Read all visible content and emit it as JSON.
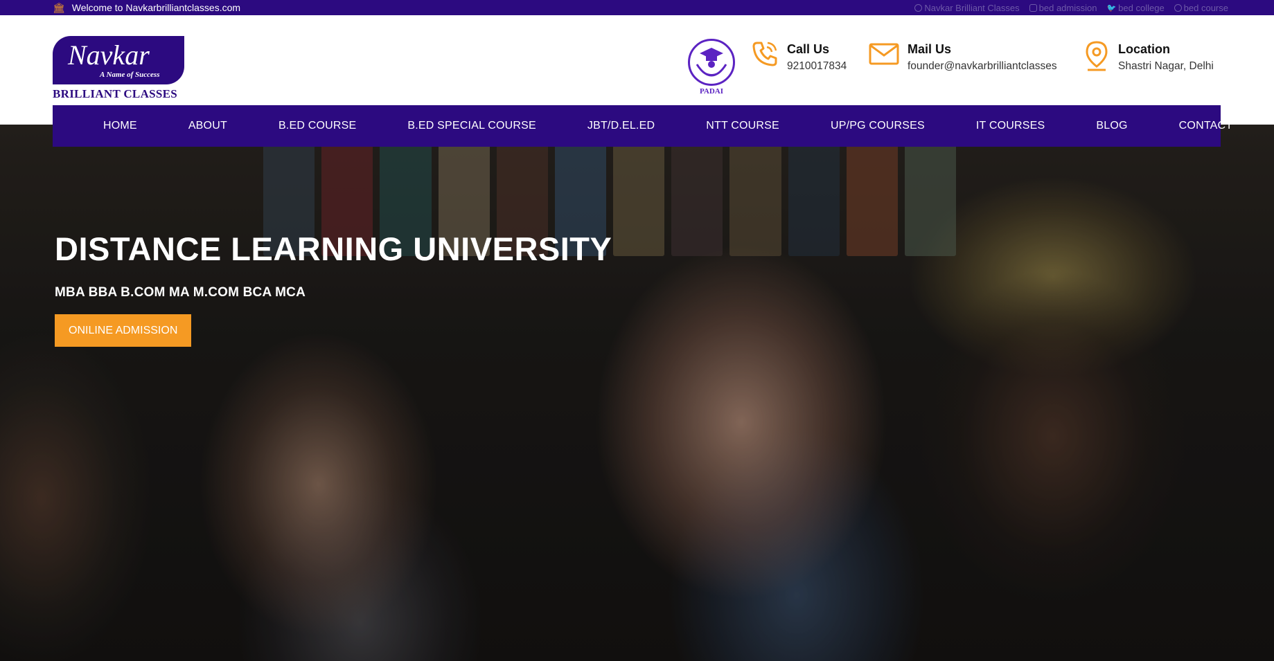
{
  "topbar": {
    "welcome": "Welcome to Navkarbrilliantclasses.com",
    "social": [
      {
        "icon": "facebook-icon",
        "label": "Navkar Brilliant Classes"
      },
      {
        "icon": "instagram-icon",
        "label": "bed admission"
      },
      {
        "icon": "twitter-icon",
        "label": "bed college"
      },
      {
        "icon": "pinterest-icon",
        "label": "bed course"
      }
    ]
  },
  "logo": {
    "script": "Navkar",
    "tagline": "A Name of Success",
    "brand": "BRILLIANT CLASSES"
  },
  "padai": {
    "label": "PADAI"
  },
  "contacts": {
    "call": {
      "title": "Call Us",
      "value": "9210017834"
    },
    "mail": {
      "title": "Mail Us",
      "value": "founder@navkarbrilliantclasses"
    },
    "location": {
      "title": "Location",
      "value": "Shastri Nagar, Delhi"
    }
  },
  "nav": [
    "HOME",
    "ABOUT",
    "B.ED COURSE",
    "B.ED SPECIAL COURSE",
    "JBT/D.EL.ED",
    "NTT COURSE",
    "UP/PG COURSES",
    "IT COURSES",
    "BLOG",
    "CONTACT"
  ],
  "hero": {
    "title": "DISTANCE LEARNING UNIVERSITY",
    "subtitle": "MBA BBA B.COM MA M.COM BCA MCA",
    "button": "ONILINE ADMISSION"
  },
  "colors": {
    "primary": "#2c0a80",
    "accent": "#f59a23"
  }
}
